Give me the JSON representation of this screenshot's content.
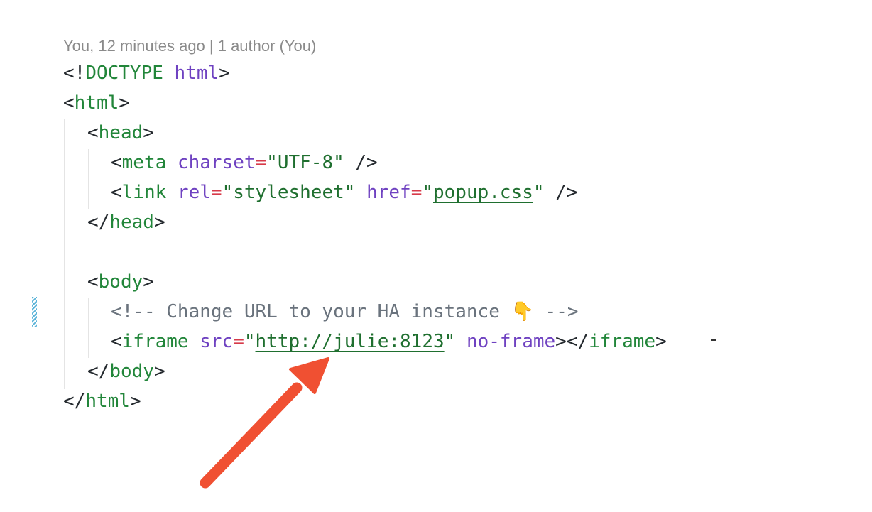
{
  "blame": {
    "text": "You, 12 minutes ago | 1 author (You)"
  },
  "code": {
    "line1": {
      "open": "<!",
      "doctype": "DOCTYPE",
      "sp": " ",
      "html": "html",
      "close": ">"
    },
    "line2": {
      "lt": "<",
      "tag": "html",
      "gt": ">"
    },
    "line3": {
      "lt": "<",
      "tag": "head",
      "gt": ">"
    },
    "line4": {
      "lt": "<",
      "tag": "meta",
      "sp1": " ",
      "attr": "charset",
      "eq": "=",
      "val": "\"UTF-8\"",
      "end": " />"
    },
    "line5": {
      "lt": "<",
      "tag": "link",
      "sp1": " ",
      "attr1": "rel",
      "eq1": "=",
      "val1": "\"stylesheet\"",
      "sp2": " ",
      "attr2": "href",
      "eq2": "=",
      "q1": "\"",
      "href": "popup.css",
      "q2": "\"",
      "end": " />"
    },
    "line6": {
      "lt": "</",
      "tag": "head",
      "gt": ">"
    },
    "line8": {
      "lt": "<",
      "tag": "body",
      "gt": ">"
    },
    "line9": {
      "comment": "<!-- Change URL to your HA instance 👇 -->"
    },
    "line10": {
      "lt": "<",
      "tag": "iframe",
      "sp1": " ",
      "attr1": "src",
      "eq1": "=",
      "q1": "\"",
      "src": "http://julie:8123",
      "q2": "\"",
      "sp2": " ",
      "attr2": "no-frame",
      "gt": ">",
      "lt2": "</",
      "tag2": "iframe",
      "gt2": ">"
    },
    "line11": {
      "lt": "</",
      "tag": "body",
      "gt": ">"
    },
    "line12": {
      "lt": "</",
      "tag": "html",
      "gt": ">"
    }
  },
  "colors": {
    "tag": "#22863a",
    "attribute": "#6f42c1",
    "equals": "#d73a49",
    "comment": "#6a737d",
    "arrow": "#f05032",
    "change_marker": "#5ab3d8"
  },
  "annotation": {
    "icon": "arrow-icon"
  }
}
